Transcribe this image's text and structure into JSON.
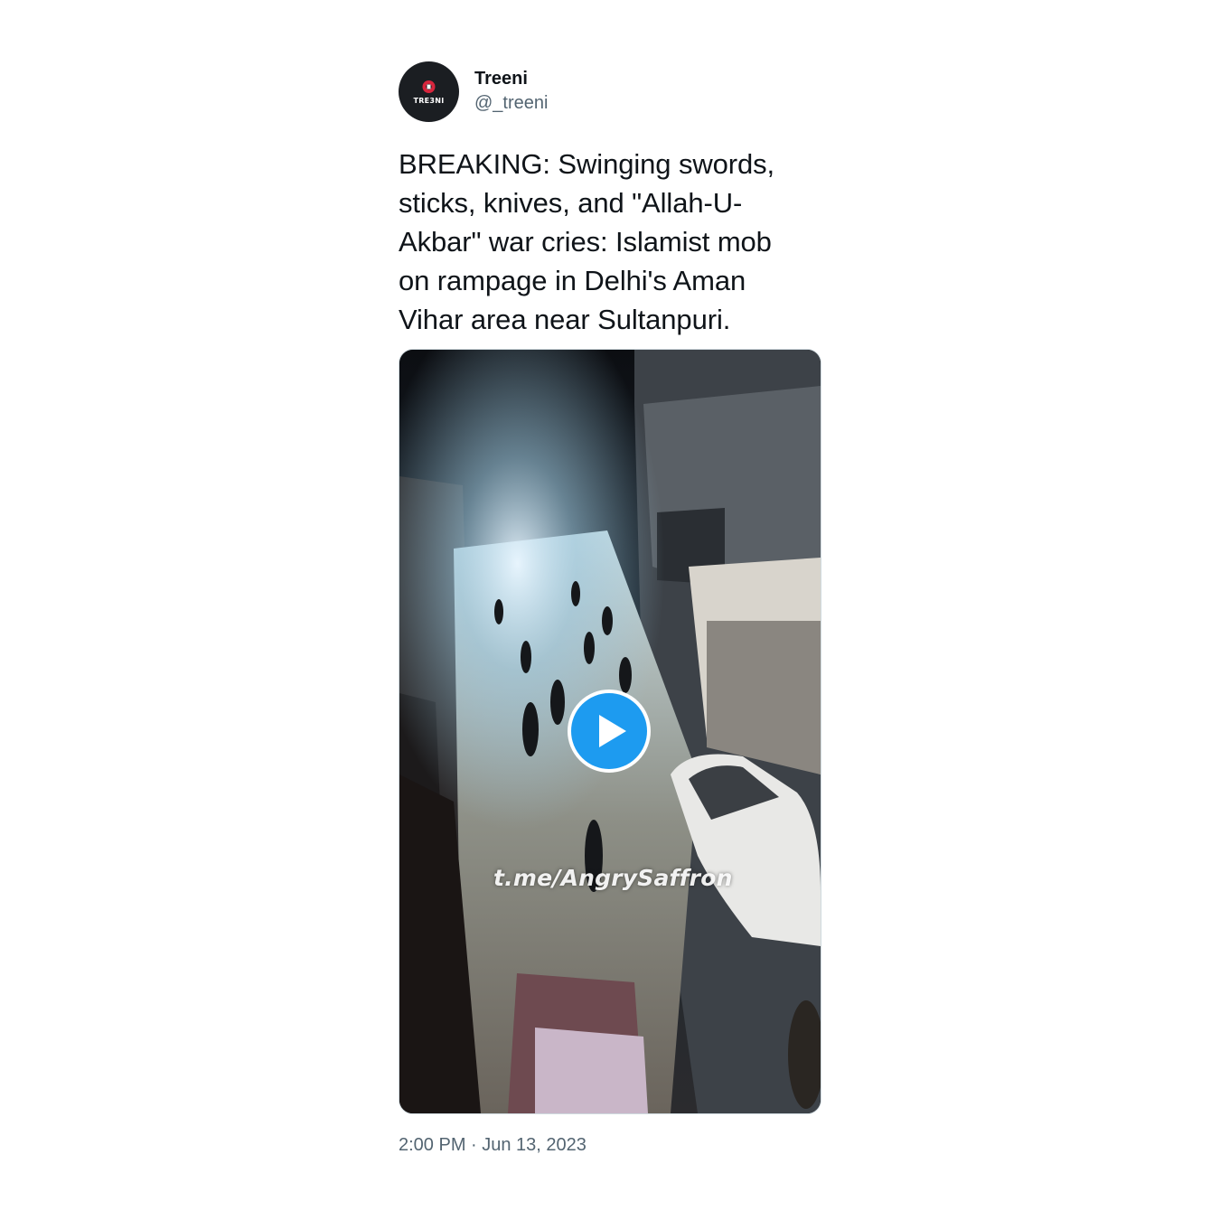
{
  "author": {
    "display_name": "Treeni",
    "handle": "@_treeni",
    "avatar_text": "TRE3NI",
    "avatar_icon": "treeni-logo-icon"
  },
  "tweet": {
    "text": "BREAKING: Swinging swords, sticks, knives, and \"Allah-U-Akbar\" war cries: Islamist mob on rampage in Delhi's Aman Vihar area near Sultanpuri."
  },
  "media": {
    "type": "video",
    "watermark": "t.me/AngrySaffron",
    "play_icon": "play-icon"
  },
  "meta": {
    "timestamp": "2:00 PM · Jun 13, 2023"
  },
  "colors": {
    "accent": "#1d9bf0",
    "text_primary": "#0f1419",
    "text_secondary": "#536471",
    "border": "#cfd9de",
    "avatar_bg": "#1b1e22",
    "logo_red": "#d7263d"
  }
}
